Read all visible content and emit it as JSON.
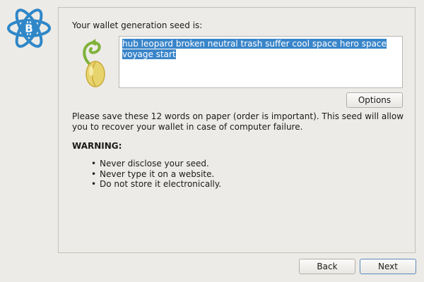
{
  "app": {
    "logo_icon": "electrum-bitcoin-logo-icon",
    "brand_color": "#3a85c9"
  },
  "seed_page": {
    "prompt": "Your wallet generation seed is:",
    "seed_icon": "seed-sprout-icon",
    "seed_words": "hub leopard broken neutral trash suffer cool space hero space voyage start",
    "options_label": "Options",
    "info": "Please save these 12 words on paper (order is important). This seed will allow you to recover your wallet in case of computer failure.",
    "warning_title": "WARNING:",
    "warnings": [
      "Never disclose your seed.",
      "Never type it on a website.",
      "Do not store it electronically."
    ]
  },
  "footer": {
    "back_label": "Back",
    "next_label": "Next"
  }
}
